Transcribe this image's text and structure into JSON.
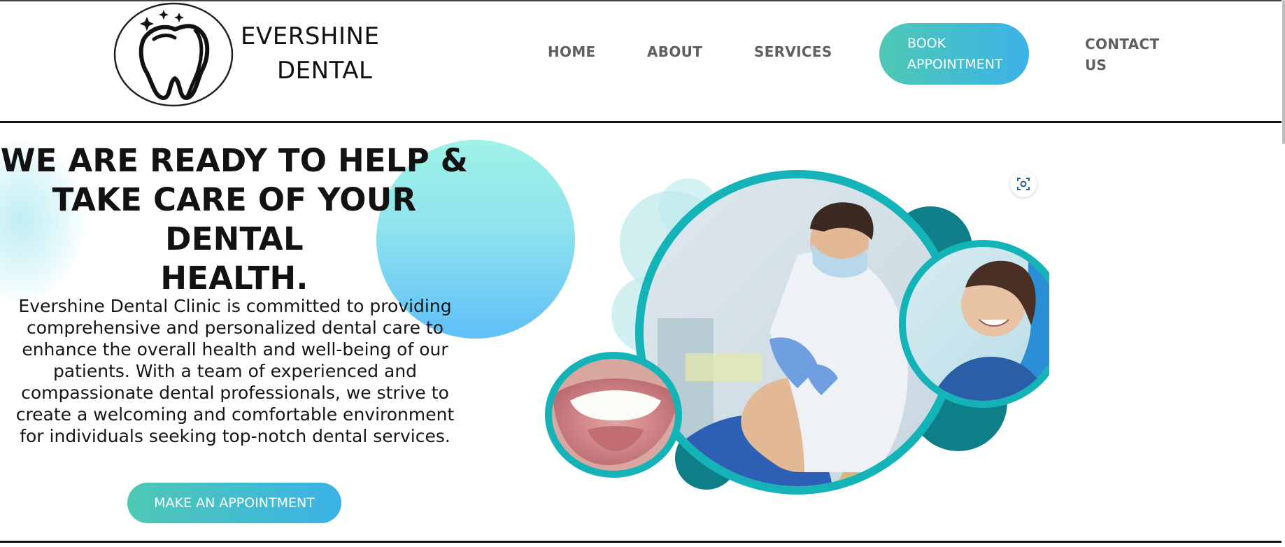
{
  "brand": {
    "name_line1": "EVERSHINE",
    "name_line2": "DENTAL",
    "logo_icon": "tooth-logo-icon"
  },
  "nav": {
    "home": "HOME",
    "about": "ABOUT",
    "services": "SERVICES",
    "book_line1": "BOOK",
    "book_line2": "APPOINTMENT",
    "contact_line1": "CONTACT",
    "contact_line2": "US"
  },
  "hero": {
    "title_line1": "WE ARE READY TO HELP &",
    "title_line2": "TAKE CARE OF YOUR DENTAL",
    "title_line3": "HEALTH.",
    "desc_lines": [
      "Evershine Dental Clinic is committed to providing",
      "comprehensive and personalized dental care to",
      "enhance the overall health and well-being of our",
      "patients. With a team of experienced and",
      "compassionate dental professionals, we strive to",
      "create a welcoming and comfortable environment",
      "for individuals seeking top-notch dental services."
    ],
    "cta": "MAKE AN APPOINTMENT"
  },
  "collage": {
    "main_image": "dentist-examining-patient",
    "side_image": "smiling-patient-in-chair",
    "small_image": "smiling-mouth-teeth",
    "scan_icon": "scan-lens-icon"
  },
  "colors": {
    "accent_start": "#4ec8b4",
    "accent_end": "#3bb2e8",
    "teal_ring": "#14b3b8",
    "text": "#121212",
    "nav_text": "#5f5f5f"
  }
}
